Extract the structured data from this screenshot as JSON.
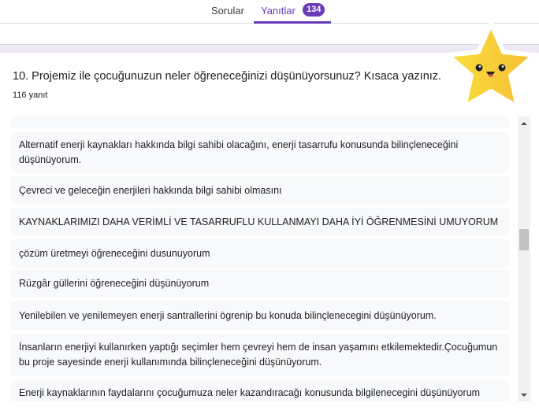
{
  "tabs": {
    "questions": "Sorular",
    "responses": "Yanıtlar",
    "responses_count": "134"
  },
  "question": {
    "title": "10. Projemiz ile çocuğunuzun neler öğreneceğinizi düşünüyorsunuz? Kısaca yazınız.",
    "count": "116 yanıt"
  },
  "answers": [
    "Alternatif enerji kaynakları hakkında bilgi sahibi olacağını, enerji tasarrufu konusunda bilinçleneceğini düşünüyorum.",
    "Çevreci ve geleceğin enerjileri hakkında bilgi sahibi olmasını",
    "KAYNAKLARIMIZI DAHA VERİMLİ VE TASARRUFLU KULLANMAYI DAHA İYİ ÖĞRENMESİNİ UMUYORUM",
    "çözüm üretmeyi öğreneceğini dusunuyorum",
    "Rüzgâr güllerini öğreneceğini düşünüyorum",
    "Yenilebilen ve yenilemeyen enerji santrallerini ögrenip bu konuda bilinçlenecegini düşünüyorum.",
    "İnsanların enerjiyi kullanırken yaptığı seçimler hem çevreyi hem de insan yaşamını etkilemektedir.Çocuğumun bu proje sayesinde enerji kullanımında bilinçleneceğini düşünüyorum.",
    "Enerji kaynaklarının faydalarını çocuğumuza neler kazandıracağı konusunda bilgilenecegini düşünüyorum"
  ],
  "scroll_position": 0.45
}
